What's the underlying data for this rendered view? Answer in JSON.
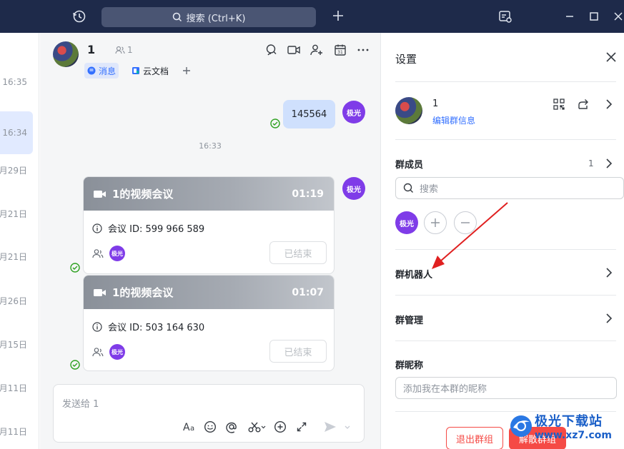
{
  "titlebar": {
    "search_placeholder": "搜索 (Ctrl+K)"
  },
  "sidebar": {
    "items": [
      {
        "time": "16:35"
      },
      {
        "time": "16:34"
      },
      {
        "time": "月29日"
      },
      {
        "time": "月21日"
      },
      {
        "time": "月21日"
      },
      {
        "time": "月26日"
      },
      {
        "time": "月15日"
      },
      {
        "time": "月11日"
      },
      {
        "time": "月11日"
      }
    ]
  },
  "chat": {
    "group_name": "1",
    "member_count": "1",
    "tabs": [
      {
        "label": "消息"
      },
      {
        "label": "云文档"
      }
    ],
    "message": {
      "text": "145564",
      "sender_badge": "极光"
    },
    "time_separator": "16:33",
    "meetings": [
      {
        "title": "1的视频会议",
        "duration": "01:19",
        "meeting_id": "会议 ID: 599 966 589",
        "participant_badge": "极光",
        "status": "已结束",
        "sender_badge": "极光"
      },
      {
        "title": "1的视频会议",
        "duration": "01:07",
        "meeting_id": "会议 ID: 503 164 630",
        "participant_badge": "极光",
        "status": "已结束"
      }
    ],
    "input_placeholder": "发送给 1"
  },
  "settings": {
    "title": "设置",
    "group_name": "1",
    "edit_info": "编辑群信息",
    "members_label": "群成员",
    "members_count": "1",
    "member_search_placeholder": "搜索",
    "member_badge": "极光",
    "bot_label": "群机器人",
    "manage_label": "群管理",
    "nickname_label": "群昵称",
    "nickname_placeholder": "添加我在本群的昵称",
    "leave_button": "退出群组",
    "disband_button": "解散群组"
  },
  "watermark": {
    "title": "极光下载站",
    "url": "www.xz7.com"
  },
  "colors": {
    "accent": "#3370ff",
    "avatar_badge": "#7f3ce8",
    "danger": "#f54a45",
    "titlebar": "#1e2a4a",
    "annotation_arrow": "#e02020"
  }
}
